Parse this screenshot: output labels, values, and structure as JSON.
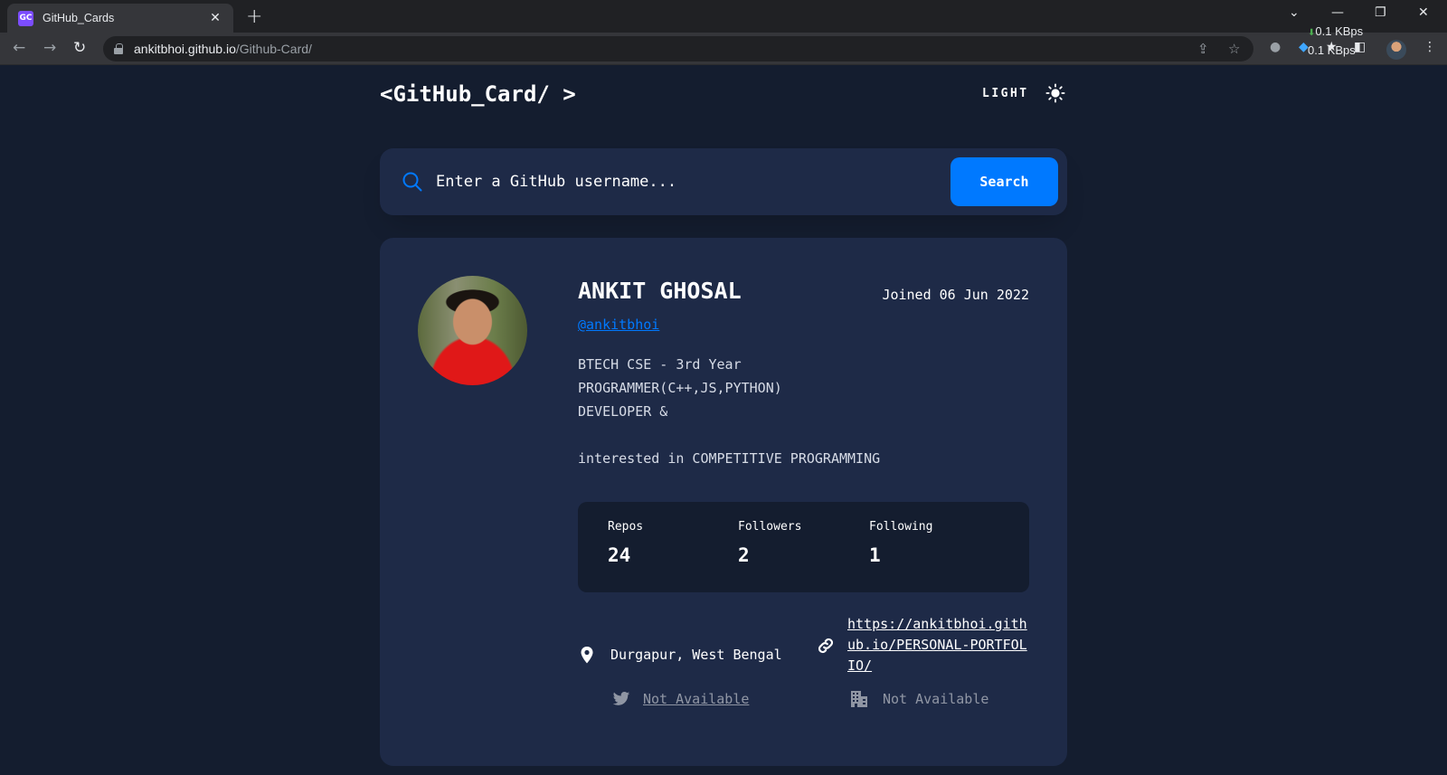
{
  "browser": {
    "tab_title": "GitHub_Cards",
    "tab_favicon": "GC",
    "url_host": "ankitbhoi.github.io",
    "url_path": "/Github-Card/",
    "net_speed_top": "0.1 KBps",
    "net_speed_bottom": "0.1 KBps"
  },
  "header": {
    "logo": "<GitHub_Card/ >",
    "theme_label": "LIGHT"
  },
  "search": {
    "placeholder": "Enter a GitHub username...",
    "button_label": "Search"
  },
  "profile": {
    "name": "ANKIT GHOSAL",
    "joined": "Joined 06 Jun 2022",
    "login": "@ankitbhoi",
    "bio_lines": [
      "BTECH CSE - 3rd Year",
      "PROGRAMMER(C++,JS,PYTHON)",
      "DEVELOPER &",
      "",
      "interested in COMPETITIVE PROGRAMMING"
    ]
  },
  "stats": {
    "repos_label": "Repos",
    "repos_value": "24",
    "followers_label": "Followers",
    "followers_value": "2",
    "following_label": "Following",
    "following_value": "1"
  },
  "links": {
    "location": "Durgapur, West Bengal",
    "website": "https://ankitbhoi.github.io/PERSONAL-PORTFOLIO/",
    "twitter": "Not Available",
    "company": "Not Available"
  },
  "colors": {
    "background": "#141d2f",
    "card": "#1e2a47",
    "accent": "#0079ff"
  }
}
